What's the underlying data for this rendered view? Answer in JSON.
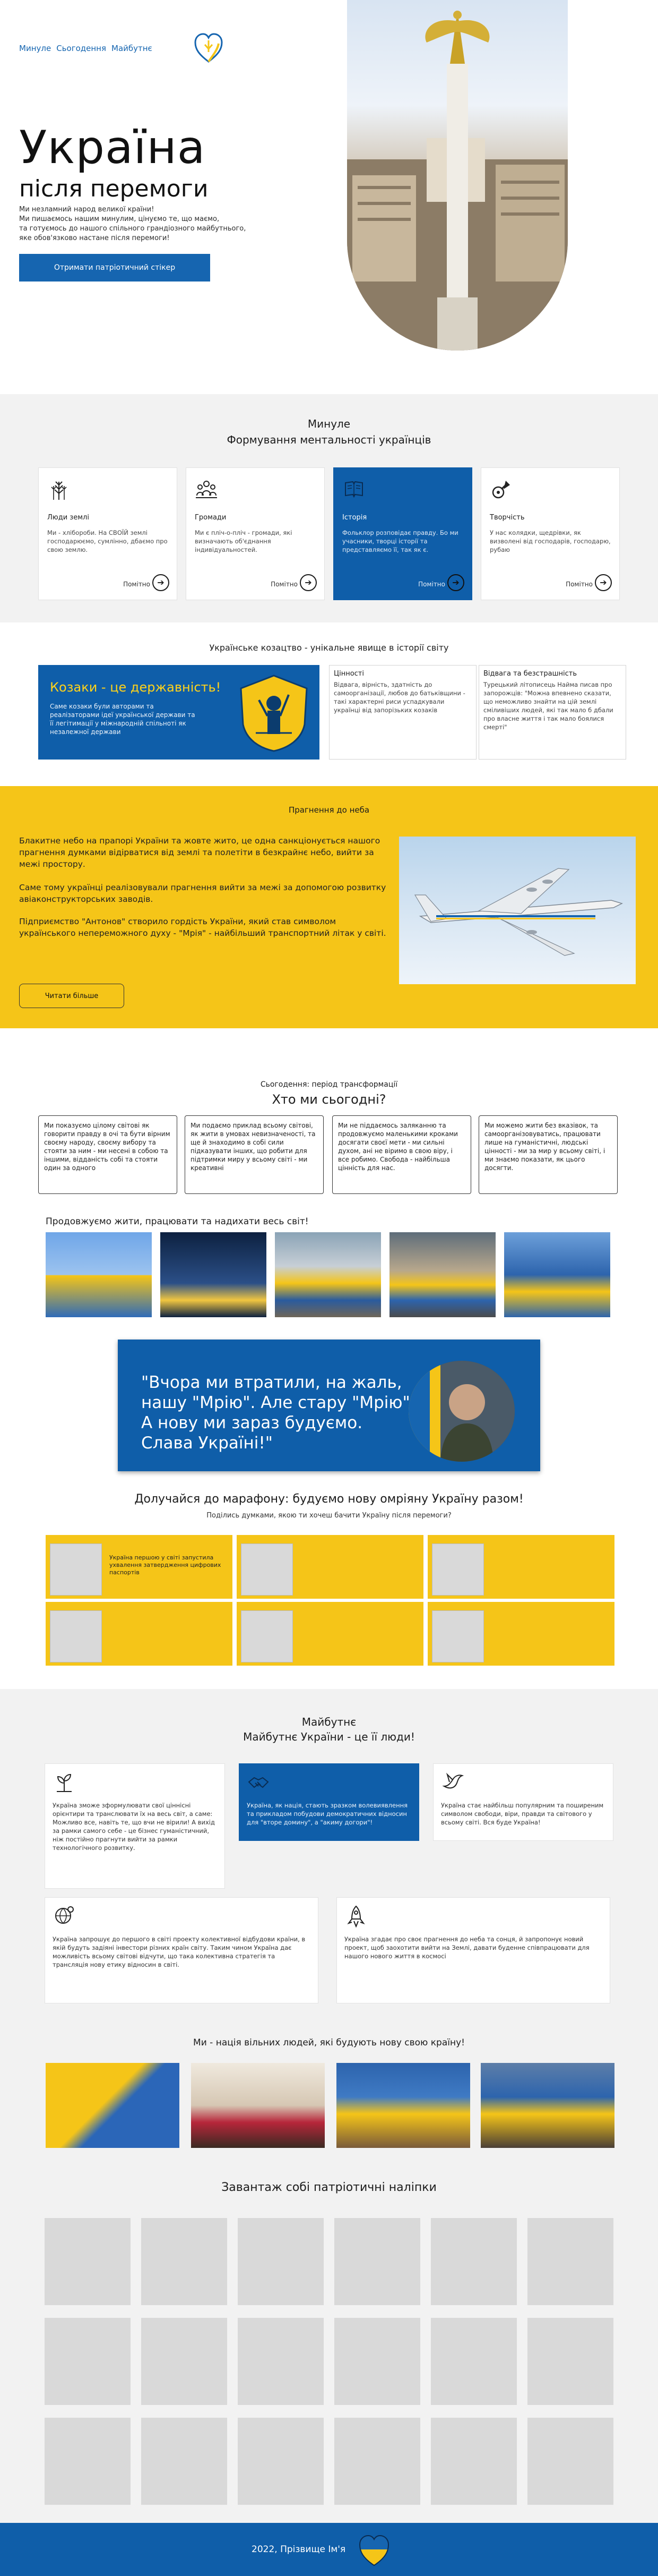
{
  "nav": {
    "items": [
      "Минуле",
      "Сьогодення",
      "Майбутнє"
    ]
  },
  "hero": {
    "title": "Україна",
    "subtitle": "після перемоги",
    "text_lines": [
      "Ми незламний народ великої країни!",
      "Ми пишаємось нашим минулим, цінуємо те, що маємо,",
      "та готуємось до нашого спільного  грандіозного майбутнього,",
      "яке обов'язково настане після перемоги!"
    ],
    "button": "Отримати патріотичний стікер"
  },
  "past": {
    "label": "Минуле",
    "title": "Формування ментальності українців",
    "cards": [
      {
        "title": "Люди землі",
        "text": "Ми - хлібороби. На СВОЇЙ землі господарюємо, сумлінно, дбаємо про свою землю.",
        "more": "Помітно",
        "icon": "wheat-icon"
      },
      {
        "title": "Громади",
        "text": "Ми є ​​пліч-о-пліч - громади, які визначають об'єднання індивідуальностей.",
        "more": "Помітно",
        "icon": "community-icon"
      },
      {
        "title": "Історія",
        "text": "Фольклор розповідає правду. Бо ми учасники, творці історії та представляємо її, так як є.",
        "more": "Помітно",
        "icon": "book-icon"
      },
      {
        "title": "Творчість",
        "text": "У нас колядки, щедрівки, як визволені від господарів, господарю, рубаю",
        "more": "Помітно",
        "icon": "guitar-icon"
      }
    ]
  },
  "cossack": {
    "title": "Українське козацтво - унікальне явище в історії світу",
    "blue": {
      "heading": "Козаки - це державність!",
      "text": "Саме козаки були авторами та реалізаторами ідеї української держави та її легітимації у міжнародній спільноті як незалежної держави"
    },
    "card1": {
      "heading": "Цінності",
      "text": "Відвага, вірність, здатність до самоорганізації, любов до батьківщини - такі характерні риси успадкували українці від запорізьких козаків"
    },
    "card2": {
      "heading": "Відвага та безстрашність",
      "text": "Турецький літописець Найма писав про запорожців: \"Можна впевнено сказати, що неможливо знайти на цій землі сміливіших людей, які так мало б дбали про власне життя і так мало боялися смерті\""
    },
    "emblem_icon": "cossack-emblem-icon"
  },
  "yellow": {
    "heading": "Прагнення до неба",
    "p1": "Блакитне небо на прапорі України та жовте жито, це одна санкціонується нашого прагнення думками відірватися від землі та полетіти в безкрайнє небо, вийти за межі простору.",
    "p2": "Саме тому українці реалізовували прагнення вийти за межі за допомогою розвитку авіаконструкторських заводів.",
    "p3": "Підприємство \"Антонов\" створило гордість України, який став символом українського непереможного духу - \"Мрія\" - найбільший транспортний літак у світі.",
    "button": "Читати більше"
  },
  "present": {
    "label": "Сьогодення: період трансформації",
    "title": "Хто ми сьогодні?",
    "cards": [
      "Ми показуємо цілому світові як говорити правду в очі та бути вірним своєму народу, своєму вибору та стояти за ним - ми несені в собою та іншими, відданість собі та стояти один за одного",
      "Ми подаємо приклад всьому світові, як жити в умовах невизначеності, та ще й знаходимо в собі сили підказувати інших, що робити для підтримки миру у всьому світі - ми креативні",
      "Ми не піддаємось заляканню та продовжуємо маленькими кроками досягати своєї мети - ми сильні духом, ані не віримо в свою віру, і все робимо. Свобода - найбільша цінність для нас.",
      "Ми можемо жити без вказівок, та самоорганізовуватись, працювати лише на гуманістичні, людські цінності - ми за мир у всьому світі, і ми знаємо показати, як цього досягти."
    ],
    "continue_title": "Продовжуємо жити, працювати та надихати весь світ!",
    "quote": "\"Вчора ми втратили, на жаль, нашу \"Мрію\". Але стару \"Мрію\". А нову ми зараз будуємо. Слава Україні!\""
  },
  "marathon": {
    "title": "Долучайся до марафону: будуємо нову омріяну Україну разом!",
    "subtitle": "Поділись думками, якою ти хочеш бачити Україну після перемоги?",
    "first_card_text": "Україна першою у світі запустила ухвалення затвердження цифрових паспортів"
  },
  "future": {
    "label": "Майбутнє",
    "title": "Майбутнє України - це її люди!",
    "cards": [
      {
        "text": "Україна зможе зформулювати свої ціннісні орієнтири та транслювати їх на весь світ, а саме: Можливо все, навіть те, що вчи не вірили! А вихід за рамки самого себе - це бізнес гуманістичний, ніж постійно прагнути вийти за рамки технологічного розвитку.",
        "icon": "growth-icon"
      },
      {
        "text": "Україна, як нація, стають зразком волевиявлення та прикладом побудови демократичних відносин для \"вторе домину\", а \"акиму догори\"!",
        "icon": "handshake-icon"
      },
      {
        "text": "Україна стає найбільш популярним та поширеним символом свободи, віри, правди та світового у всьому світі. Вся буде Україна!",
        "icon": "dove-icon"
      },
      {
        "text": "Україна запрошує до першого в світі проекту колективної відбудови країни, в якій будуть задіяні інвестори різних країн світу. Таким чином Україна дає можливість всьому світові відчути, що така колективна стратегія та трансляція нову етику відносин в світі.",
        "icon": "globe-gear-icon"
      },
      {
        "text": "Україна згадає про своє прагнення до неба та сонця, й запропонує новий проект, щоб заохотити вийти на Землі, давати буденне співпрацювати для нашого нового життя в космосі",
        "icon": "rocket-icon"
      }
    ]
  },
  "free": {
    "title": "Ми - нація вільних людей, які будують нову свою країну!"
  },
  "stickers": {
    "title": "Завантаж собі патріотичні наліпки"
  },
  "footer": {
    "text": "2022, Прізвище Ім'я"
  },
  "colors": {
    "blue": "#0f5ea9",
    "yellow": "#f5c518",
    "gray_bg": "#f2f2f2"
  }
}
